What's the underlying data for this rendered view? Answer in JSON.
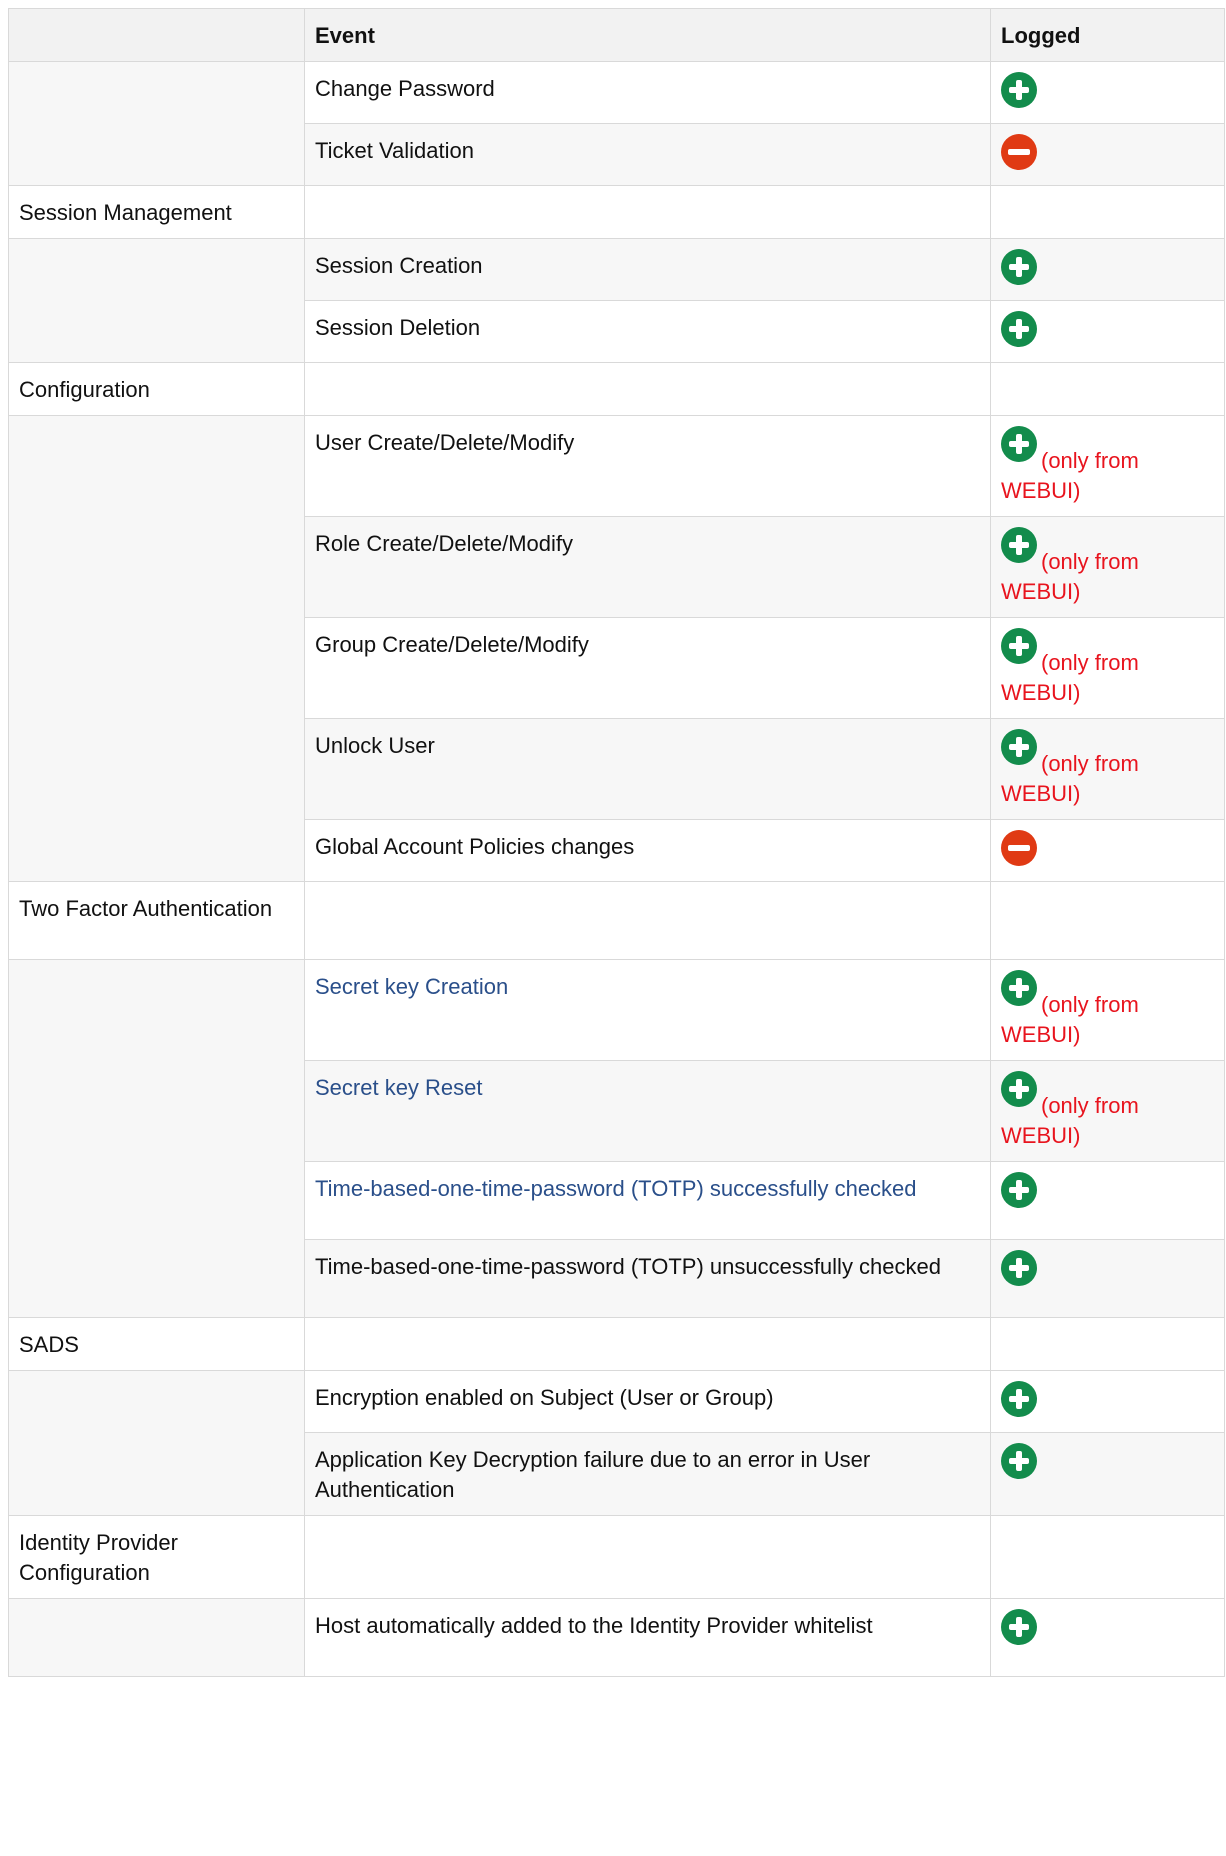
{
  "colors": {
    "plus": "#138c4c",
    "minus": "#e03a14",
    "note": "#e8141e",
    "link": "#2a4f8a"
  },
  "table": {
    "headers": {
      "category": "",
      "event": "Event",
      "logged": "Logged"
    },
    "rows": [
      {
        "kind": "event",
        "event": "Change Password",
        "logged": "plus-icon",
        "note": ""
      },
      {
        "kind": "event",
        "event": "Ticket Validation",
        "logged": "minus-icon",
        "note": ""
      },
      {
        "kind": "category",
        "label": "Session Management"
      },
      {
        "kind": "event",
        "event": "Session Creation",
        "logged": "plus-icon",
        "note": ""
      },
      {
        "kind": "event",
        "event": "Session Deletion",
        "logged": "plus-icon",
        "note": ""
      },
      {
        "kind": "category",
        "label": "Configuration"
      },
      {
        "kind": "event",
        "event": "User Create/Delete/Modify",
        "logged": "plus-icon",
        "note_a": "(only from",
        "note_b": "WEBUI)"
      },
      {
        "kind": "event",
        "event": "Role Create/Delete/Modify",
        "logged": "plus-icon",
        "note_a": "(only from",
        "note_b": "WEBUI)"
      },
      {
        "kind": "event",
        "event": "Group Create/Delete/Modify",
        "logged": "plus-icon",
        "note_a": "(only from",
        "note_b": "WEBUI)"
      },
      {
        "kind": "event",
        "event": "Unlock User",
        "logged": "plus-icon",
        "note_a": "(only from",
        "note_b": "WEBUI)"
      },
      {
        "kind": "event",
        "event": "Global Account Policies changes",
        "logged": "minus-icon",
        "note": ""
      },
      {
        "kind": "category",
        "label": "Two Factor Authentication"
      },
      {
        "kind": "event",
        "event": "Secret key Creation",
        "link": true,
        "logged": "plus-icon",
        "note_a": "(only from",
        "note_b": "WEBUI)"
      },
      {
        "kind": "event",
        "event": "Secret key Reset",
        "link": true,
        "logged": "plus-icon",
        "note_a": "(only from",
        "note_b": "WEBUI)"
      },
      {
        "kind": "event",
        "event": "Time-based-one-time-password (TOTP) successfully checked",
        "link": true,
        "logged": "plus-icon",
        "note": ""
      },
      {
        "kind": "event",
        "event": "Time-based-one-time-password (TOTP) unsuccessfully checked",
        "logged": "plus-icon",
        "note": ""
      },
      {
        "kind": "category",
        "label": "SADS"
      },
      {
        "kind": "event",
        "event": "Encryption enabled on Subject (User or Group)",
        "logged": "plus-icon",
        "note": ""
      },
      {
        "kind": "event",
        "event": "Application Key Decryption failure due to an error in User Authentication",
        "logged": "plus-icon",
        "note": ""
      },
      {
        "kind": "category",
        "label": "Identity Provider Configuration"
      },
      {
        "kind": "event",
        "event": "Host automatically added to the Identity Provider whitelist",
        "logged": "plus-icon",
        "note": ""
      }
    ]
  }
}
